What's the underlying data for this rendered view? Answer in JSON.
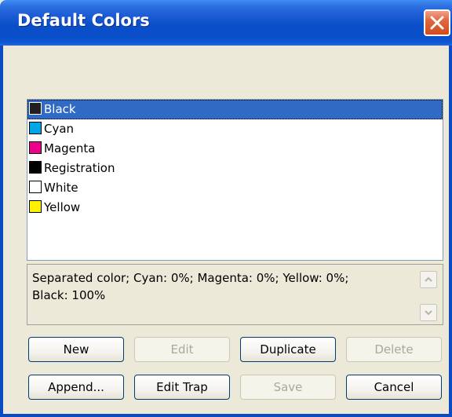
{
  "window": {
    "title": "Default Colors"
  },
  "colors": [
    {
      "name": "Black",
      "swatch": "#231F20",
      "selected": true
    },
    {
      "name": "Cyan",
      "swatch": "#00A6E6",
      "selected": false
    },
    {
      "name": "Magenta",
      "swatch": "#EC008C",
      "selected": false
    },
    {
      "name": "Registration",
      "swatch": "#000000",
      "selected": false
    },
    {
      "name": "White",
      "swatch": "#FFFFFF",
      "selected": false
    },
    {
      "name": "Yellow",
      "swatch": "#FFF200",
      "selected": false
    }
  ],
  "info": {
    "line1": "Separated color; Cyan: 0%; Magenta: 0%; Yellow: 0%;",
    "line2": "Black: 100%"
  },
  "buttons": {
    "new": "New",
    "edit": "Edit",
    "duplicate": "Duplicate",
    "delete": "Delete",
    "append": "Append...",
    "edit_trap": "Edit Trap",
    "save": "Save",
    "cancel": "Cancel"
  },
  "theme": {
    "selection": "#316AC5",
    "titlebar": "#0A4FC9",
    "dialog_bg": "#ECE9D8"
  }
}
